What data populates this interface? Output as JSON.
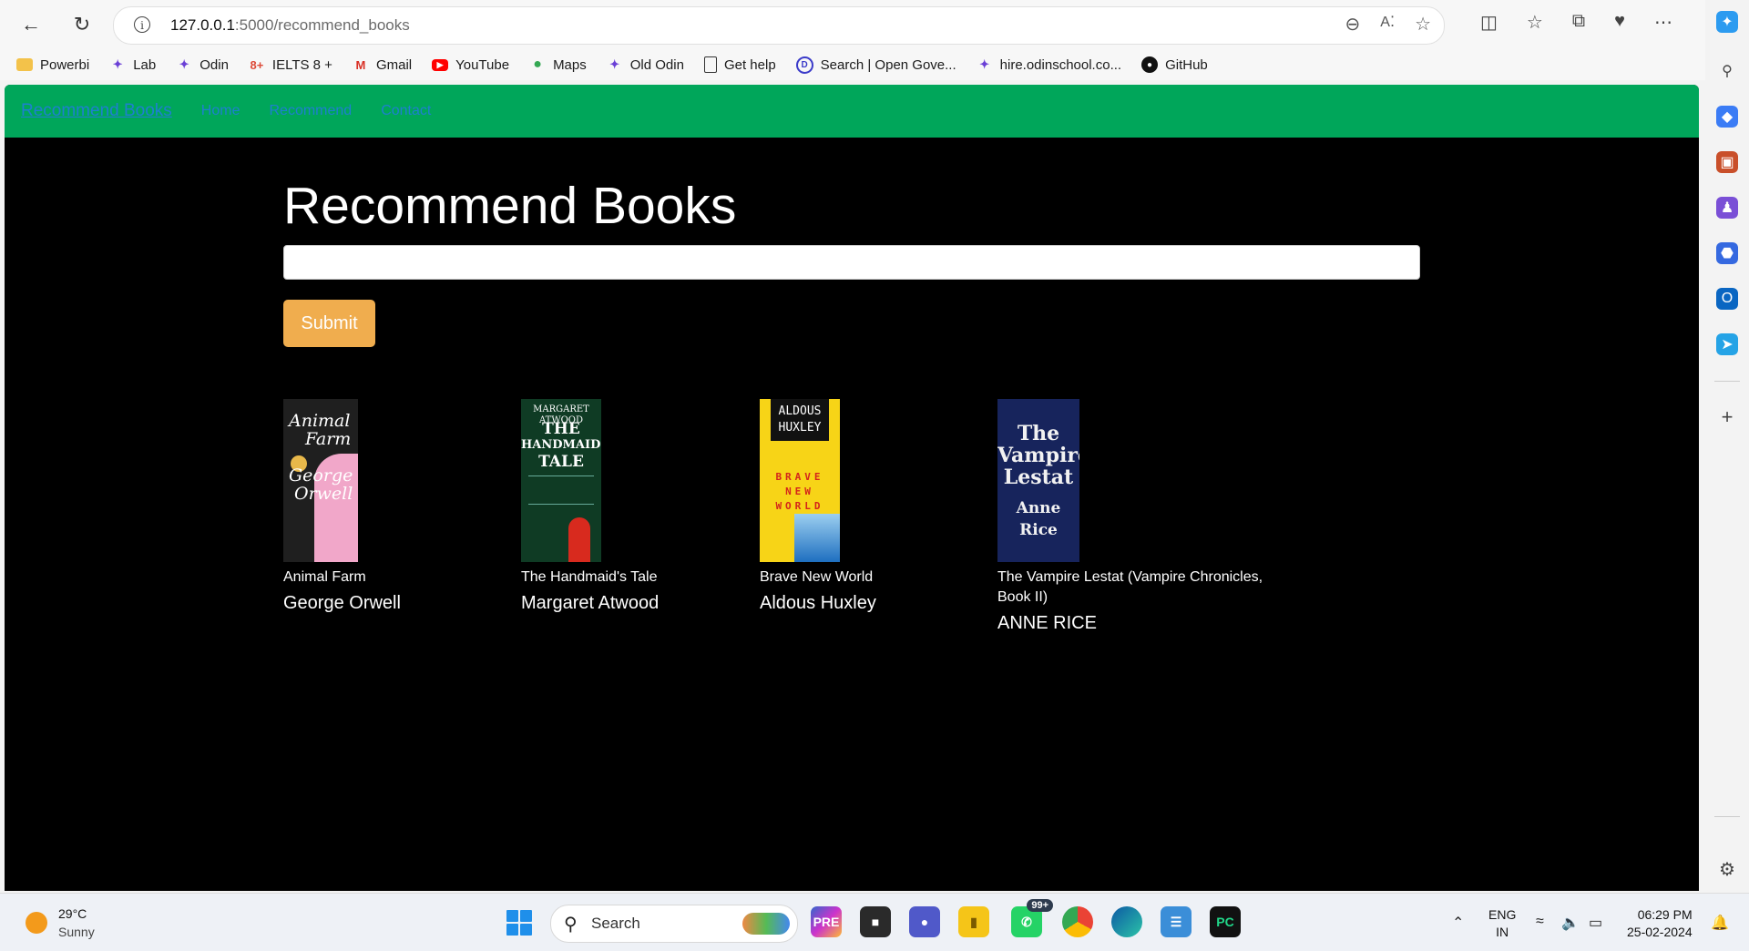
{
  "browser": {
    "url_host": "127.0.0.1",
    "url_path": ":5000/recommend_books",
    "bookmarks": [
      {
        "label": "Powerbi",
        "icon": "folder-icon"
      },
      {
        "label": "Lab",
        "icon": "odin-bird-icon"
      },
      {
        "label": "Odin",
        "icon": "odin-bird-icon"
      },
      {
        "label": "IELTS 8 +",
        "icon": "google-plus-icon"
      },
      {
        "label": "Gmail",
        "icon": "gmail-icon"
      },
      {
        "label": "YouTube",
        "icon": "youtube-icon"
      },
      {
        "label": "Maps",
        "icon": "maps-pin-icon"
      },
      {
        "label": "Old Odin",
        "icon": "odin-bird-icon"
      },
      {
        "label": "Get help",
        "icon": "document-icon"
      },
      {
        "label": "Search | Open Gove...",
        "icon": "open-gov-icon"
      },
      {
        "label": "hire.odinschool.co...",
        "icon": "odin-bird-icon"
      },
      {
        "label": "GitHub",
        "icon": "github-icon"
      }
    ]
  },
  "site": {
    "brand": "Recommend Books",
    "nav_links": [
      "Home",
      "Recommend",
      "Contact"
    ]
  },
  "main": {
    "heading": "Recommend Books",
    "search_value": "",
    "submit_label": "Submit",
    "books": [
      {
        "title": "Animal Farm",
        "author": "George Orwell",
        "cover_text": [
          "Animal",
          "Farm",
          "George",
          "Orwell"
        ],
        "cover_bg": "#2a2a2a"
      },
      {
        "title": "The Handmaid's Tale",
        "author": "Margaret Atwood",
        "cover_text": [
          "MARGARET ATWOOD",
          "THE",
          "HANDMAID'S",
          "TALE"
        ],
        "cover_bg": "#0f3b24"
      },
      {
        "title": "Brave New World",
        "author": "Aldous Huxley",
        "cover_text": [
          "ALDOUS",
          "HUXLEY",
          "BRAVE",
          "NEW",
          "WORLD"
        ],
        "cover_bg": "#f7d417"
      },
      {
        "title": "The Vampire Lestat (Vampire Chronicles, Book II)",
        "author": "ANNE RICE",
        "cover_text": [
          "The",
          "Vampire",
          "Lestat",
          "Anne Rice"
        ],
        "cover_bg": "#1a2a66"
      }
    ]
  },
  "taskbar": {
    "temperature": "29°C",
    "condition": "Sunny",
    "search_label": "Search",
    "whatsapp_badge": "99+",
    "lang_top": "ENG",
    "lang_bottom": "IN",
    "time": "06:29 PM",
    "date": "25-02-2024"
  }
}
